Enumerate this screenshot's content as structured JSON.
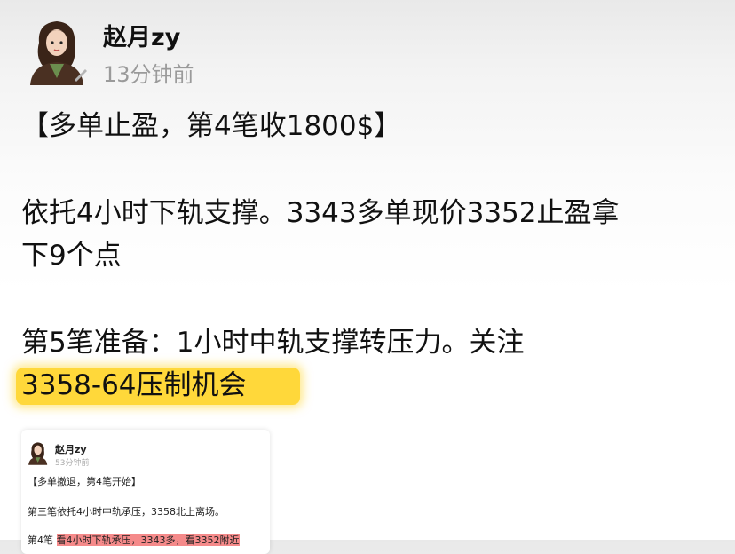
{
  "author": {
    "name": "赵月zy",
    "time": "13分钟前"
  },
  "post": {
    "title": "【多单止盈，第4笔收1800$】",
    "para1_line1": "依托4小时下轨支撑。3343多单现价3352止盈拿",
    "para1_line2": "下9个点",
    "para2_line1": "第5笔准备：1小时中轨支撑转压力。关注",
    "para2_highlight": "3358-64压制机会",
    "highlight_color": "#ffd83a"
  },
  "embedded_card": {
    "name": "赵月zy",
    "time": "53分钟前",
    "title": "【多单撤退，第4笔开始】",
    "line1": "第三笔依托4小时中轨承压，3358北上离场。",
    "line2_prefix": "第4笔",
    "line2_highlight": "看4小时下轨承压，3343多，看3352附近",
    "highlight_color": "#f58a8a"
  }
}
